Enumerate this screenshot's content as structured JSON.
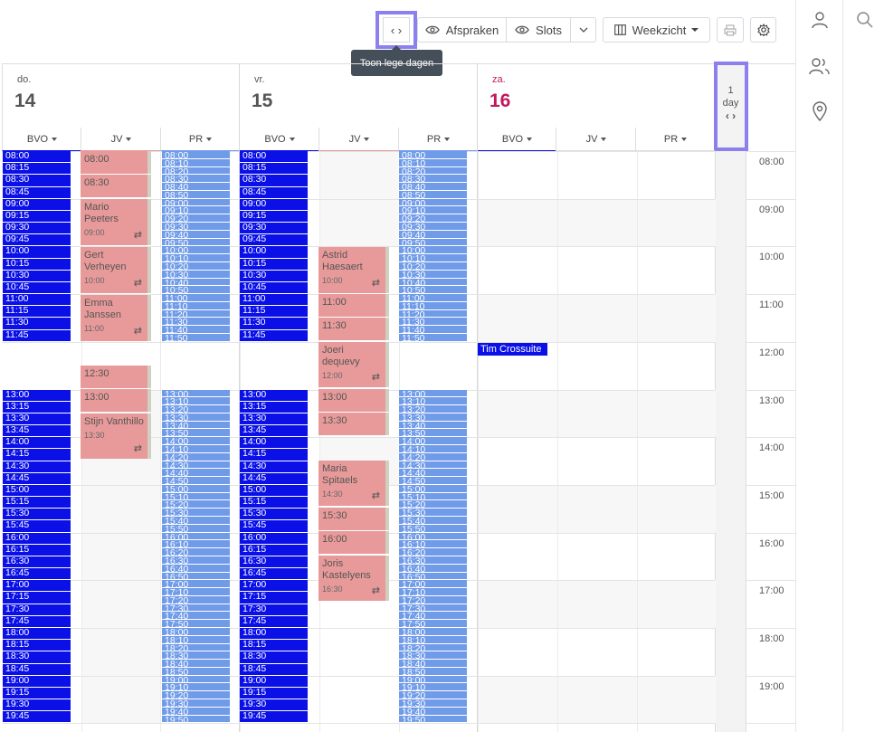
{
  "toolbar": {
    "toggle_empty_days_icon": "‹ ›",
    "appointments_label": "Afspraken",
    "slots_label": "Slots",
    "view_label": "Weekzicht",
    "tooltip": "Toon lege dagen"
  },
  "icons": {
    "eye": "eye-icon",
    "chevron": "chevron-down-icon",
    "columns": "columns-icon",
    "print": "printer-icon",
    "settings": "gear-icon",
    "user": "user-icon",
    "users": "users-icon",
    "location": "location-pin-icon",
    "search": "search-icon"
  },
  "colors": {
    "highlight": "#8b80ee",
    "slot_dark": "#0a10e6",
    "slot_light": "#6f9be8",
    "appointment": "#e89a9a",
    "saturday": "#c2185b"
  },
  "days": [
    {
      "dow": "do.",
      "num": "14"
    },
    {
      "dow": "vr.",
      "num": "15"
    },
    {
      "dow": "za.",
      "num": "16"
    }
  ],
  "collapsed": {
    "count": "1",
    "unit": "day",
    "icon": "‹ ›"
  },
  "columns": [
    "BVO",
    "JV",
    "PR"
  ],
  "time_labels": [
    "08:00",
    "09:00",
    "10:00",
    "11:00",
    "12:00",
    "13:00",
    "14:00",
    "15:00",
    "16:00",
    "17:00",
    "18:00",
    "19:00"
  ],
  "appointments": {
    "thu_jv": [
      {
        "name": "08:00",
        "time": ""
      },
      {
        "name": "08:30",
        "time": ""
      },
      {
        "name": "Mario Peeters",
        "time": "09:00"
      },
      {
        "name": "Gert Verheyen",
        "time": "10:00"
      },
      {
        "name": "Emma Janssen",
        "time": "11:00"
      },
      {
        "name": "12:30",
        "time": ""
      },
      {
        "name": "13:00",
        "time": ""
      },
      {
        "name": "Stijn Vanthillo",
        "time": "13:30"
      }
    ],
    "fri_jv": [
      {
        "name": "Astrid Haesaert",
        "time": "10:00"
      },
      {
        "name": "11:00",
        "time": ""
      },
      {
        "name": "11:30",
        "time": ""
      },
      {
        "name": "Joeri dequevy",
        "time": "12:00"
      },
      {
        "name": "13:00",
        "time": ""
      },
      {
        "name": "13:30",
        "time": ""
      },
      {
        "name": "Maria Spitaels",
        "time": "14:30"
      },
      {
        "name": "15:30",
        "time": ""
      },
      {
        "name": "16:00",
        "time": ""
      },
      {
        "name": "Joris Kastelyens",
        "time": "16:30"
      }
    ],
    "sat_event": "Tim Crossuite"
  }
}
